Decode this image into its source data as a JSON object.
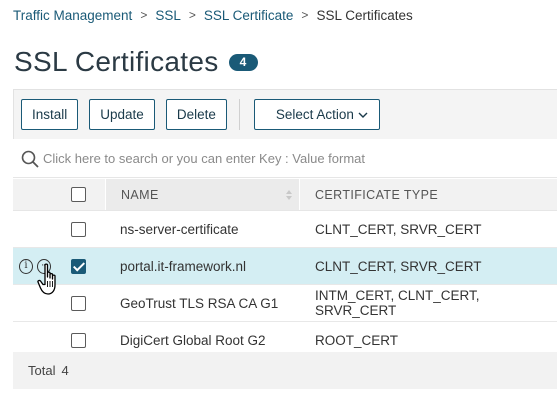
{
  "breadcrumb": {
    "items": [
      "Traffic Management",
      "SSL",
      "SSL Certificate"
    ],
    "current": "SSL Certificates"
  },
  "page": {
    "title": "SSL Certificates",
    "count": "4"
  },
  "toolbar": {
    "install_label": "Install",
    "update_label": "Update",
    "delete_label": "Delete",
    "select_action_label": "Select Action"
  },
  "search": {
    "placeholder": "Click here to search or you can enter Key : Value format"
  },
  "table": {
    "columns": {
      "name": "NAME",
      "type": "CERTIFICATE TYPE"
    },
    "rows": [
      {
        "name": "ns-server-certificate",
        "type": "CLNT_CERT, SRVR_CERT",
        "checked": false
      },
      {
        "name": "portal.it-framework.nl",
        "type": "CLNT_CERT, SRVR_CERT",
        "checked": true
      },
      {
        "name": "GeoTrust TLS RSA CA G1",
        "type": "INTM_CERT, CLNT_CERT, SRVR_CERT",
        "checked": false
      },
      {
        "name": "DigiCert Global Root G2",
        "type": "ROOT_CERT",
        "checked": false
      }
    ]
  },
  "footer": {
    "total_label": "Total",
    "total_value": "4"
  },
  "colors": {
    "accent": "#1a5a77",
    "selected_row": "#d4eef3"
  }
}
